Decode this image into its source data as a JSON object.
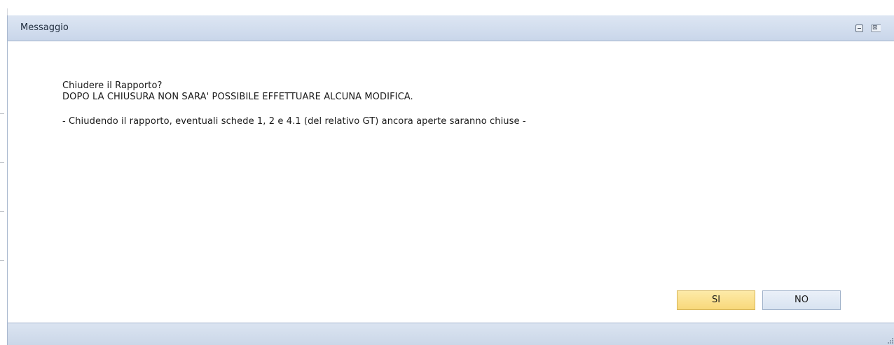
{
  "dialog": {
    "title": "Messaggio",
    "minimize_icon": "minimize-icon",
    "close_icon": "close-icon",
    "close_glyph": "⊠",
    "message": {
      "line1": "Chiudere il Rapporto?",
      "line2": "DOPO LA CHIUSURA NON SARA' POSSIBILE EFFETTUARE ALCUNA MODIFICA.",
      "line3": "- Chiudendo il rapporto, eventuali schede 1, 2 e 4.1 (del relativo GT) ancora aperte saranno chiuse -"
    },
    "buttons": {
      "yes_label": "SI",
      "no_label": "NO"
    }
  },
  "colors": {
    "titlebar": "#c9d6ea",
    "primary_button": "#f8d87a",
    "secondary_button": "#d8e3f1"
  }
}
